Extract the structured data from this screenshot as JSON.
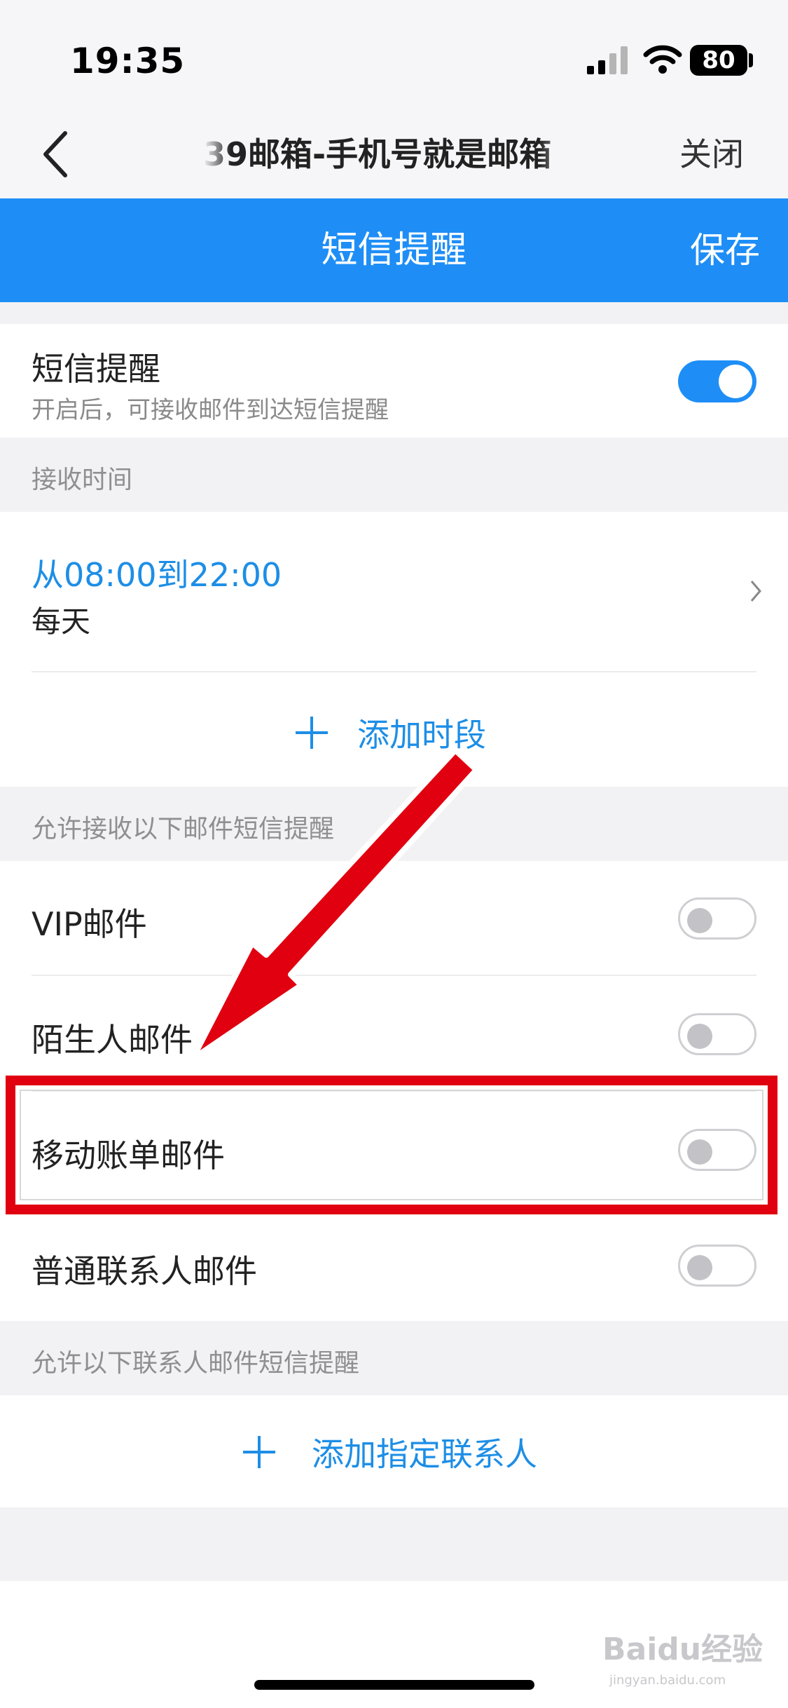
{
  "status_bar": {
    "time": "19:35",
    "battery": "80"
  },
  "browser": {
    "title": "39邮箱-手机号就是邮箱",
    "close_label": "关闭"
  },
  "app_bar": {
    "title": "短信提醒",
    "save_label": "保存"
  },
  "sms_reminder": {
    "label": "短信提醒",
    "description": "开启后，可接收邮件到达短信提醒",
    "enabled": true
  },
  "receive_time": {
    "section_title": "接收时间",
    "range": "从08:00到22:00",
    "frequency": "每天",
    "add_label": "添加时段"
  },
  "mail_types": {
    "section_title": "允许接收以下邮件短信提醒",
    "items": [
      {
        "label": "VIP邮件",
        "enabled": false
      },
      {
        "label": "陌生人邮件",
        "enabled": false
      },
      {
        "label": "移动账单邮件",
        "enabled": false
      },
      {
        "label": "普通联系人邮件",
        "enabled": false
      }
    ]
  },
  "contacts": {
    "section_title": "允许以下联系人邮件短信提醒",
    "add_label": "添加指定联系人"
  },
  "watermark": {
    "text": "Baidu经验",
    "sub": "jingyan.baidu.com"
  },
  "colors": {
    "accent": "#1e8ef6",
    "annotation": "#e00010"
  }
}
